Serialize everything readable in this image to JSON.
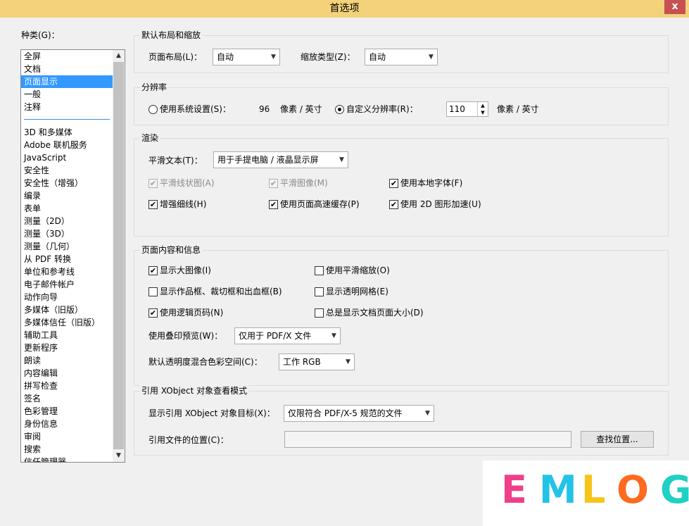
{
  "window": {
    "title": "首选项",
    "close_label": "x"
  },
  "categories": {
    "label": "种类(G)：",
    "group1": [
      "全屏",
      "文档",
      "页面显示",
      "一般",
      "注释"
    ],
    "selected": "页面显示",
    "group2": [
      "3D 和多媒体",
      "Adobe 联机服务",
      "JavaScript",
      "安全性",
      "安全性（增强）",
      "编录",
      "表单",
      "测量（2D）",
      "测量（3D）",
      "测量（几何）",
      "从 PDF 转换",
      "单位和参考线",
      "电子邮件帐户",
      "动作向导",
      "多媒体（旧版）",
      "多媒体信任（旧版）",
      "辅助工具",
      "更新程序",
      "朗读",
      "内容编辑",
      "拼写检查",
      "签名",
      "色彩管理",
      "身份信息",
      "审阅",
      "搜索",
      "信任管理器"
    ]
  },
  "layout_zoom": {
    "title": "默认布局和缩放",
    "page_layout_label": "页面布局(L)：",
    "page_layout_value": "自动",
    "zoom_label": "缩放类型(Z)：",
    "zoom_value": "自动"
  },
  "resolution": {
    "title": "分辨率",
    "system_label": "使用系统设置(S)：",
    "system_value": "96",
    "unit1": "像素 / 英寸",
    "custom_label": "自定义分辨率(R)：",
    "custom_value": "110",
    "unit2": "像素 / 英寸",
    "selected": "custom"
  },
  "rendering": {
    "title": "渲染",
    "smooth_text_label": "平滑文本(T)：",
    "smooth_text_value": "用于手提电脑 / 液晶显示屏",
    "smooth_lineart": {
      "label": "平滑线状图(A)",
      "checked": true,
      "disabled": true
    },
    "smooth_images": {
      "label": "平滑图像(M)",
      "checked": true,
      "disabled": true
    },
    "local_fonts": {
      "label": "使用本地字体(F)",
      "checked": true
    },
    "enhance_thin": {
      "label": "增强细线(H)",
      "checked": true
    },
    "page_cache": {
      "label": "使用页面高速缓存(P)",
      "checked": true
    },
    "gpu_2d": {
      "label": "使用 2D 图形加速(U)",
      "checked": true
    }
  },
  "page_content": {
    "title": "页面内容和信息",
    "large_images": {
      "label": "显示大图像(I)",
      "checked": true
    },
    "smooth_zoom": {
      "label": "使用平滑缩放(O)",
      "checked": false
    },
    "art_trim": {
      "label": "显示作品框、裁切框和出血框(B)",
      "checked": false
    },
    "transparency_grid": {
      "label": "显示透明网格(E)",
      "checked": false
    },
    "logical_page": {
      "label": "使用逻辑页码(N)",
      "checked": true
    },
    "doc_page_size": {
      "label": "总是显示文档页面大小(D)",
      "checked": false
    },
    "overprint_label": "使用叠印预览(W)：",
    "overprint_value": "仅用于 PDF/X 文件",
    "blend_label": "默认透明度混合色彩空间(C)：",
    "blend_value": "工作 RGB"
  },
  "xobject": {
    "title": "引用 XObject 对象查看模式",
    "show_label": "显示引用 XObject 对象目标(X)：",
    "show_value": "仅限符合 PDF/X-5 规范的文件",
    "location_label": "引用文件的位置(C)：",
    "location_value": "",
    "browse_label": "查找位置..."
  },
  "watermark": {
    "letters": [
      "E",
      "M",
      "L",
      "O",
      "G"
    ],
    "colors": [
      "#ee3f8a",
      "#22c3e6",
      "#f5c518",
      "#ff6a1e",
      "#1fd0c4"
    ]
  },
  "ui_colors": {
    "titlebar": "#f3d27a",
    "close": "#c75050",
    "selection": "#3399ff"
  }
}
